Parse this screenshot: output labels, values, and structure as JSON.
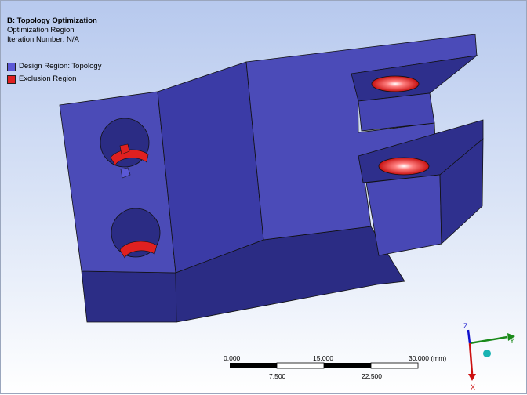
{
  "info": {
    "title": "B: Topology Optimization",
    "subtitle": "Optimization Region",
    "iteration": "Iteration Number: N/A"
  },
  "legend": {
    "items": [
      {
        "label": "Design Region: Topology",
        "color": "#5b59d6"
      },
      {
        "label": "Exclusion Region",
        "color": "#e02020"
      }
    ]
  },
  "scale": {
    "top_labels": [
      "0.000",
      "15.000",
      "30.000 (mm)"
    ],
    "bottom_labels": [
      "7.500",
      "22.500"
    ]
  },
  "triad": {
    "z": "Z",
    "y": "Y",
    "x": "X"
  },
  "colors": {
    "design": "#4a4ab8",
    "exclusion": "#e02020"
  }
}
